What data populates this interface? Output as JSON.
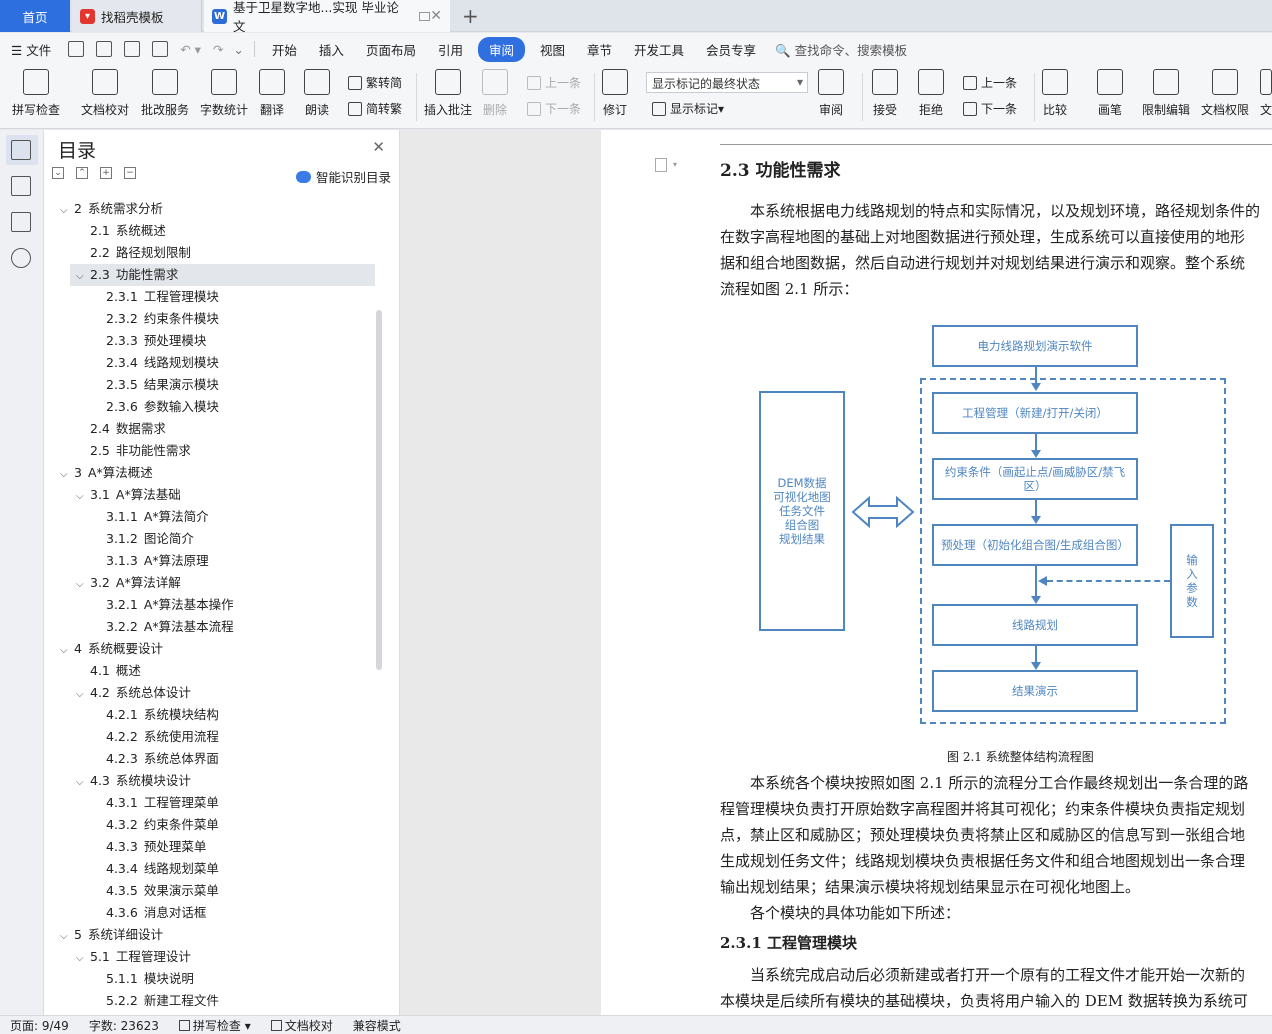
{
  "tabs": {
    "home": "首页",
    "template": "找稻壳模板",
    "document": "基于卫星数字地...实现 毕业论文"
  },
  "menu": {
    "file": "文件",
    "items": [
      "开始",
      "插入",
      "页面布局",
      "引用",
      "审阅",
      "视图",
      "章节",
      "开发工具",
      "会员专享"
    ],
    "active": "审阅",
    "search": "查找命令、搜索模板"
  },
  "ribbon": {
    "spellcheck": "拼写检查",
    "proofread": "文档校对",
    "batch": "批改服务",
    "wordcount": "字数统计",
    "translate": "翻译",
    "read": "朗读",
    "trad": "繁转简",
    "simp": "简转繁",
    "insert_comment": "插入批注",
    "delete": "删除",
    "prev": "上一条",
    "next": "下一条",
    "revise": "修订",
    "markup_combo": "显示标记的最终状态",
    "show_markup": "显示标记",
    "review": "审阅",
    "accept": "接受",
    "reject": "拒绝",
    "prev2": "上一条",
    "next2": "下一条",
    "compare": "比较",
    "pen": "画笔",
    "restrict": "限制编辑",
    "permission": "文档权限",
    "more": "文"
  },
  "outline": {
    "title": "目录",
    "smart": "智能识别目录",
    "items": [
      {
        "num": "2",
        "text": "系统需求分析",
        "level": 0,
        "exp": true
      },
      {
        "num": "2.1",
        "text": "系统概述",
        "level": 1
      },
      {
        "num": "2.2",
        "text": "路径规划限制",
        "level": 1
      },
      {
        "num": "2.3",
        "text": "功能性需求",
        "level": 1,
        "exp": true,
        "sel": true
      },
      {
        "num": "2.3.1",
        "text": "工程管理模块",
        "level": 2
      },
      {
        "num": "2.3.2",
        "text": "约束条件模块",
        "level": 2
      },
      {
        "num": "2.3.3",
        "text": "预处理模块",
        "level": 2
      },
      {
        "num": "2.3.4",
        "text": "线路规划模块",
        "level": 2
      },
      {
        "num": "2.3.5",
        "text": "结果演示模块",
        "level": 2
      },
      {
        "num": "2.3.6",
        "text": "参数输入模块",
        "level": 2
      },
      {
        "num": "2.4",
        "text": "数据需求",
        "level": 1
      },
      {
        "num": "2.5",
        "text": "非功能性需求",
        "level": 1
      },
      {
        "num": "3",
        "text": "A*算法概述",
        "level": 0,
        "exp": true
      },
      {
        "num": "3.1",
        "text": "A*算法基础",
        "level": 1,
        "exp": true
      },
      {
        "num": "3.1.1",
        "text": "A*算法简介",
        "level": 2
      },
      {
        "num": "3.1.2",
        "text": "图论简介",
        "level": 2
      },
      {
        "num": "3.1.3",
        "text": "A*算法原理",
        "level": 2
      },
      {
        "num": "3.2",
        "text": "A*算法详解",
        "level": 1,
        "exp": true
      },
      {
        "num": "3.2.1",
        "text": "A*算法基本操作",
        "level": 2
      },
      {
        "num": "3.2.2",
        "text": "A*算法基本流程",
        "level": 2
      },
      {
        "num": "4",
        "text": "系统概要设计",
        "level": 0,
        "exp": true
      },
      {
        "num": "4.1",
        "text": "概述",
        "level": 1
      },
      {
        "num": "4.2",
        "text": "系统总体设计",
        "level": 1,
        "exp": true
      },
      {
        "num": "4.2.1",
        "text": "系统模块结构",
        "level": 2
      },
      {
        "num": "4.2.2",
        "text": "系统使用流程",
        "level": 2
      },
      {
        "num": "4.2.3",
        "text": "系统总体界面",
        "level": 2
      },
      {
        "num": "4.3",
        "text": "系统模块设计",
        "level": 1,
        "exp": true
      },
      {
        "num": "4.3.1",
        "text": "工程管理菜单",
        "level": 2
      },
      {
        "num": "4.3.2",
        "text": "约束条件菜单",
        "level": 2
      },
      {
        "num": "4.3.3",
        "text": "预处理菜单",
        "level": 2
      },
      {
        "num": "4.3.4",
        "text": "线路规划菜单",
        "level": 2
      },
      {
        "num": "4.3.5",
        "text": "效果演示菜单",
        "level": 2
      },
      {
        "num": "4.3.6",
        "text": "消息对话框",
        "level": 2
      },
      {
        "num": "5",
        "text": "系统详细设计",
        "level": 0,
        "exp": true
      },
      {
        "num": "5.1",
        "text": "工程管理设计",
        "level": 1,
        "exp": true
      },
      {
        "num": "5.1.1",
        "text": "模块说明",
        "level": 2
      },
      {
        "num": "5.2.2",
        "text": "新建工程文件",
        "level": 2
      }
    ]
  },
  "doc": {
    "heading": "2.3  功能性需求",
    "p1": [
      "本系统根据电力线路规划的特点和实际情况，以及规划环境，路径规划条件的",
      "在数字高程地图的基础上对地图数据进行预处理，生成系统可以直接使用的地形",
      "据和组合地图数据，然后自动进行规划并对规划结果进行演示和观察。整个系统",
      "流程如图 2.1 所示："
    ],
    "diagram": {
      "top": "电力线路规划演示软件",
      "b1": "工程管理（新建/打开/关闭）",
      "b2": "约束条件（画起止点/画威胁区/禁飞区）",
      "b3": "预处理（初始化组合图/生成组合图）",
      "b4": "线路规划",
      "b5": "结果演示",
      "left": "DEM数据\n可视化地图\n任务文件\n组合图\n规划结果",
      "right": "输\n入\n参\n数"
    },
    "caption": "图 2.1  系统整体结构流程图",
    "p2": [
      "本系统各个模块按照如图 2.1 所示的流程分工合作最终规划出一条合理的路",
      "程管理模块负责打开原始数字高程图并将其可视化；约束条件模块负责指定规划",
      "点，禁止区和威胁区；预处理模块负责将禁止区和威胁区的信息写到一张组合地",
      "生成规划任务文件；线路规划模块负责根据任务文件和组合地图规划出一条合理",
      "输出规划结果；结果演示模块将规划结果显示在可视化地图上。",
      "各个模块的具体功能如下所述："
    ],
    "h3": "2.3.1  工程管理模块",
    "p3": [
      "当系统完成启动后必须新建或者打开一个原有的工程文件才能开始一次新的",
      "本模块是后续所有模块的基础模块，负责将用户输入的 DEM 数据转换为系统可"
    ]
  },
  "status": {
    "page": "页面: 9/49",
    "words": "字数: 23623",
    "spell": "拼写检查",
    "proof": "文档校对",
    "compat": "兼容模式"
  }
}
